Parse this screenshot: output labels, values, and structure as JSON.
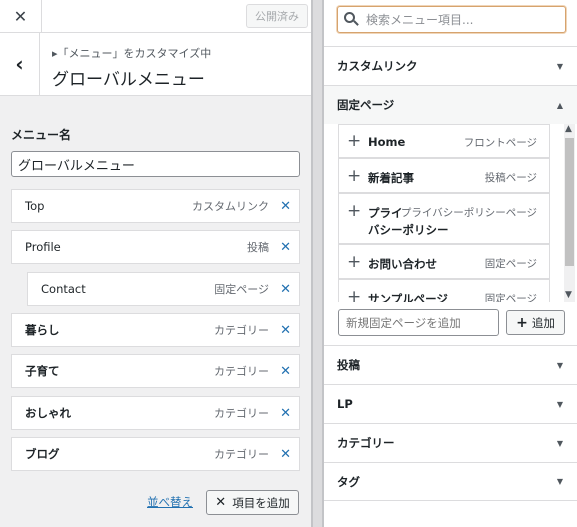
{
  "topbar": {
    "close_glyph": "✕",
    "published_label": "公開済み"
  },
  "section": {
    "back_glyph": "‹",
    "breadcrumb": "▸「メニュー」をカスタマイズ中",
    "title": "グローバルメニュー"
  },
  "menu_name": {
    "label": "メニュー名",
    "value": "グローバルメニュー"
  },
  "menu_items": [
    {
      "title": "Top",
      "type": "カスタムリンク"
    },
    {
      "title": "Profile",
      "type": "投稿"
    },
    {
      "title": "Contact",
      "type": "固定ページ"
    },
    {
      "title": "暮らし",
      "type": "カテゴリー"
    },
    {
      "title": "子育て",
      "type": "カテゴリー"
    },
    {
      "title": "おしゃれ",
      "type": "カテゴリー"
    },
    {
      "title": "ブログ",
      "type": "カテゴリー"
    }
  ],
  "remove_glyph": "✕",
  "footer": {
    "reorder_label": "並べ替え",
    "add_items_label": "項目を追加",
    "add_items_glyph": "✕"
  },
  "search": {
    "placeholder": "検索メニュー項目..."
  },
  "accordions": {
    "custom_link": "カスタムリンク",
    "pages": "固定ページ",
    "posts": "投稿",
    "lp": "LP",
    "categories": "カテゴリー",
    "tags": "タグ"
  },
  "arrow_down": "▼",
  "arrow_up": "▲",
  "available_pages": [
    {
      "title": "Home",
      "type": "フロントページ"
    },
    {
      "title": "新着記事",
      "type": "投稿ページ"
    },
    {
      "title": "プライ",
      "title2": "バシーポリシー",
      "type": "プライバシーポリシーページ"
    },
    {
      "title": "お問い合わせ",
      "type": "固定ページ"
    },
    {
      "title": "サンプルページ",
      "type": "固定ページ"
    }
  ],
  "plus_glyph": "+",
  "new_page": {
    "placeholder": "新規固定ページを追加",
    "button_label": "追加",
    "button_glyph": "+"
  },
  "icons": {
    "close": "close-icon",
    "back": "chevron-left-icon",
    "remove": "remove-icon",
    "search": "search-icon",
    "add": "plus-icon"
  }
}
